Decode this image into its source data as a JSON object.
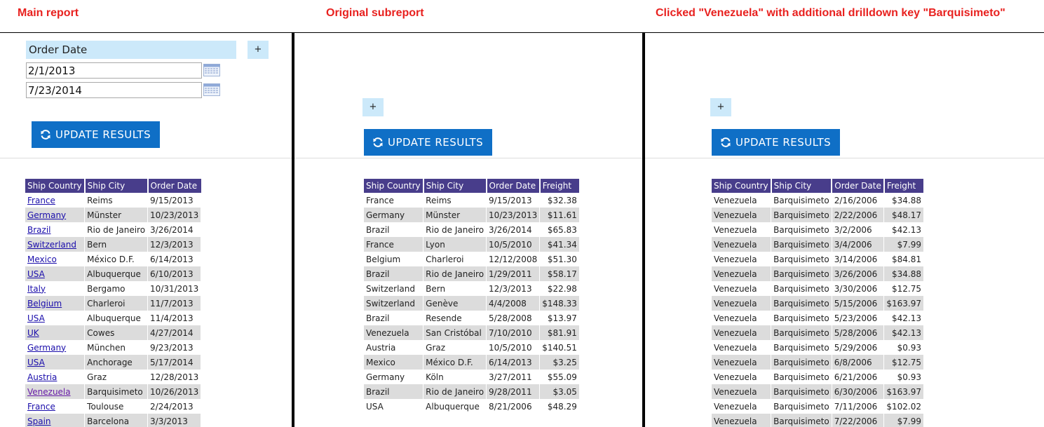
{
  "captions": {
    "main": "Main report",
    "original": "Original subreport",
    "clicked": "Clicked \"Venezuela\" with additional drilldown key \"Barquisimeto\""
  },
  "main": {
    "param_label": "Order Date",
    "plus_label": "+",
    "date_from": "2/1/2013",
    "date_to": "7/23/2014",
    "update_label": "UPDATE RESULTS",
    "headers": [
      "Ship Country",
      "Ship City",
      "Order Date"
    ],
    "rows": [
      [
        "France",
        "Reims",
        "9/15/2013"
      ],
      [
        "Germany",
        "Münster",
        "10/23/2013"
      ],
      [
        "Brazil",
        "Rio de Janeiro",
        "3/26/2014"
      ],
      [
        "Switzerland",
        "Bern",
        "12/3/2013"
      ],
      [
        "Mexico",
        "México D.F.",
        "6/14/2013"
      ],
      [
        "USA",
        "Albuquerque",
        "6/10/2013"
      ],
      [
        "Italy",
        "Bergamo",
        "10/31/2013"
      ],
      [
        "Belgium",
        "Charleroi",
        "11/7/2013"
      ],
      [
        "USA",
        "Albuquerque",
        "11/4/2013"
      ],
      [
        "UK",
        "Cowes",
        "4/27/2014"
      ],
      [
        "Germany",
        "München",
        "9/23/2013"
      ],
      [
        "USA",
        "Anchorage",
        "5/17/2014"
      ],
      [
        "Austria",
        "Graz",
        "12/28/2013"
      ],
      [
        "Venezuela",
        "Barquisimeto",
        "10/26/2013"
      ],
      [
        "France",
        "Toulouse",
        "2/24/2013"
      ],
      [
        "Spain",
        "Barcelona",
        "3/3/2013"
      ]
    ]
  },
  "original": {
    "plus_label": "+",
    "update_label": "UPDATE RESULTS",
    "headers": [
      "Ship Country",
      "Ship City",
      "Order Date",
      "Freight"
    ],
    "rows": [
      [
        "France",
        "Reims",
        "9/15/2013",
        "$32.38"
      ],
      [
        "Germany",
        "Münster",
        "10/23/2013",
        "$11.61"
      ],
      [
        "Brazil",
        "Rio de Janeiro",
        "3/26/2014",
        "$65.83"
      ],
      [
        "France",
        "Lyon",
        "10/5/2010",
        "$41.34"
      ],
      [
        "Belgium",
        "Charleroi",
        "12/12/2008",
        "$51.30"
      ],
      [
        "Brazil",
        "Rio de Janeiro",
        "1/29/2011",
        "$58.17"
      ],
      [
        "Switzerland",
        "Bern",
        "12/3/2013",
        "$22.98"
      ],
      [
        "Switzerland",
        "Genève",
        "4/4/2008",
        "$148.33"
      ],
      [
        "Brazil",
        "Resende",
        "5/28/2008",
        "$13.97"
      ],
      [
        "Venezuela",
        "San Cristóbal",
        "7/10/2010",
        "$81.91"
      ],
      [
        "Austria",
        "Graz",
        "10/5/2010",
        "$140.51"
      ],
      [
        "Mexico",
        "México D.F.",
        "6/14/2013",
        "$3.25"
      ],
      [
        "Germany",
        "Köln",
        "3/27/2011",
        "$55.09"
      ],
      [
        "Brazil",
        "Rio de Janeiro",
        "9/28/2011",
        "$3.05"
      ],
      [
        "USA",
        "Albuquerque",
        "8/21/2006",
        "$48.29"
      ]
    ]
  },
  "clicked": {
    "plus_label": "+",
    "update_label": "UPDATE RESULTS",
    "headers": [
      "Ship Country",
      "Ship City",
      "Order Date",
      "Freight"
    ],
    "rows": [
      [
        "Venezuela",
        "Barquisimeto",
        "2/16/2006",
        "$34.88"
      ],
      [
        "Venezuela",
        "Barquisimeto",
        "2/22/2006",
        "$48.17"
      ],
      [
        "Venezuela",
        "Barquisimeto",
        "3/2/2006",
        "$42.13"
      ],
      [
        "Venezuela",
        "Barquisimeto",
        "3/4/2006",
        "$7.99"
      ],
      [
        "Venezuela",
        "Barquisimeto",
        "3/14/2006",
        "$84.81"
      ],
      [
        "Venezuela",
        "Barquisimeto",
        "3/26/2006",
        "$34.88"
      ],
      [
        "Venezuela",
        "Barquisimeto",
        "3/30/2006",
        "$12.75"
      ],
      [
        "Venezuela",
        "Barquisimeto",
        "5/15/2006",
        "$163.97"
      ],
      [
        "Venezuela",
        "Barquisimeto",
        "5/23/2006",
        "$42.13"
      ],
      [
        "Venezuela",
        "Barquisimeto",
        "5/28/2006",
        "$42.13"
      ],
      [
        "Venezuela",
        "Barquisimeto",
        "5/29/2006",
        "$0.93"
      ],
      [
        "Venezuela",
        "Barquisimeto",
        "6/8/2006",
        "$12.75"
      ],
      [
        "Venezuela",
        "Barquisimeto",
        "6/21/2006",
        "$0.93"
      ],
      [
        "Venezuela",
        "Barquisimeto",
        "6/30/2006",
        "$163.97"
      ],
      [
        "Venezuela",
        "Barquisimeto",
        "7/11/2006",
        "$102.02"
      ],
      [
        "Venezuela",
        "Barquisimeto",
        "7/22/2006",
        "$7.99"
      ]
    ]
  },
  "colors": {
    "caption": "#e8211f",
    "param_bg": "#cce9fa",
    "button": "#0f6fc6",
    "table_header": "#483d8b",
    "row_alt": "#dcdcdc",
    "link": "#1a0dab",
    "link_visited": "#681da8"
  },
  "icons": {
    "calendar": "calendar-icon",
    "refresh": "refresh-icon"
  }
}
